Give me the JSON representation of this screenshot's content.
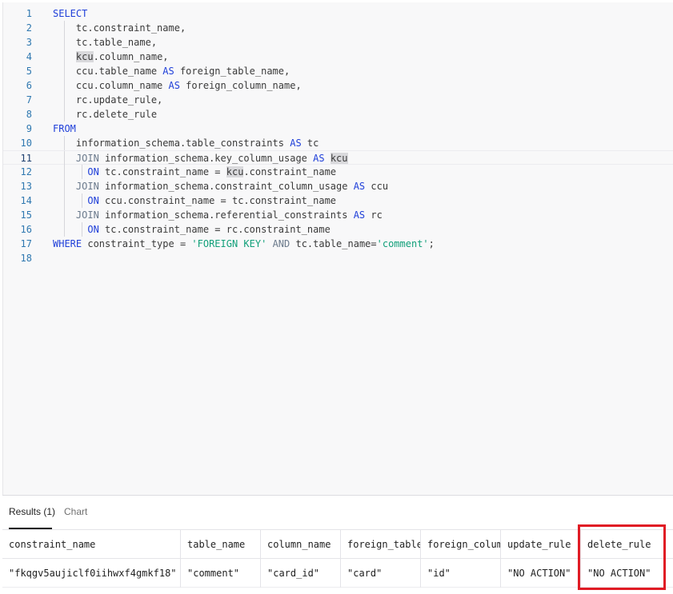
{
  "editor": {
    "lines": [
      {
        "num": "1",
        "tokens": [
          {
            "t": "SELECT",
            "c": "kw"
          }
        ]
      },
      {
        "num": "2",
        "tokens": [
          {
            "t": "    tc.constraint_name,"
          }
        ]
      },
      {
        "num": "3",
        "tokens": [
          {
            "t": "    tc.table_name,"
          }
        ]
      },
      {
        "num": "4",
        "tokens": [
          {
            "t": "    "
          },
          {
            "t": "kcu",
            "c": "hl"
          },
          {
            "t": ".column_name,"
          }
        ]
      },
      {
        "num": "5",
        "tokens": [
          {
            "t": "    ccu.table_name "
          },
          {
            "t": "AS",
            "c": "kw"
          },
          {
            "t": " foreign_table_name,"
          }
        ]
      },
      {
        "num": "6",
        "tokens": [
          {
            "t": "    ccu.column_name "
          },
          {
            "t": "AS",
            "c": "kw"
          },
          {
            "t": " foreign_column_name,"
          }
        ]
      },
      {
        "num": "7",
        "tokens": [
          {
            "t": "    rc.update_rule,"
          }
        ]
      },
      {
        "num": "8",
        "tokens": [
          {
            "t": "    rc.delete_rule"
          }
        ]
      },
      {
        "num": "9",
        "tokens": [
          {
            "t": "FROM",
            "c": "kw"
          }
        ]
      },
      {
        "num": "10",
        "tokens": [
          {
            "t": "    information_schema.table_constraints "
          },
          {
            "t": "AS",
            "c": "kw"
          },
          {
            "t": " tc"
          }
        ]
      },
      {
        "num": "11",
        "active": true,
        "tokens": [
          {
            "t": "    "
          },
          {
            "t": "JOIN",
            "c": "jw"
          },
          {
            "t": " information_schema.key_column_usage "
          },
          {
            "t": "AS",
            "c": "kw"
          },
          {
            "t": " "
          },
          {
            "t": "kcu",
            "c": "hl"
          }
        ]
      },
      {
        "num": "12",
        "tokens": [
          {
            "t": "      "
          },
          {
            "t": "ON",
            "c": "kw"
          },
          {
            "t": " tc.constraint_name = "
          },
          {
            "t": "kcu",
            "c": "hl"
          },
          {
            "t": ".constraint_name"
          }
        ]
      },
      {
        "num": "13",
        "tokens": [
          {
            "t": "    "
          },
          {
            "t": "JOIN",
            "c": "jw"
          },
          {
            "t": " information_schema.constraint_column_usage "
          },
          {
            "t": "AS",
            "c": "kw"
          },
          {
            "t": " ccu"
          }
        ]
      },
      {
        "num": "14",
        "tokens": [
          {
            "t": "      "
          },
          {
            "t": "ON",
            "c": "kw"
          },
          {
            "t": " ccu.constraint_name = tc.constraint_name"
          }
        ]
      },
      {
        "num": "15",
        "tokens": [
          {
            "t": "    "
          },
          {
            "t": "JOIN",
            "c": "jw"
          },
          {
            "t": " information_schema.referential_constraints "
          },
          {
            "t": "AS",
            "c": "kw"
          },
          {
            "t": " rc"
          }
        ]
      },
      {
        "num": "16",
        "tokens": [
          {
            "t": "      "
          },
          {
            "t": "ON",
            "c": "kw"
          },
          {
            "t": " tc.constraint_name = rc.constraint_name"
          }
        ]
      },
      {
        "num": "17",
        "tokens": [
          {
            "t": "WHERE",
            "c": "kw"
          },
          {
            "t": " constraint_type = "
          },
          {
            "t": "'FOREIGN KEY'",
            "c": "str"
          },
          {
            "t": " "
          },
          {
            "t": "AND",
            "c": "jw"
          },
          {
            "t": " tc.table_name="
          },
          {
            "t": "'comment'",
            "c": "str"
          },
          {
            "t": ";"
          }
        ]
      },
      {
        "num": "18",
        "tokens": []
      }
    ]
  },
  "results": {
    "tabs": [
      {
        "label": "Results (1)",
        "active": true
      },
      {
        "label": "Chart",
        "active": false
      }
    ],
    "columns": [
      "constraint_name",
      "table_name",
      "column_name",
      "foreign_table",
      "foreign_colum",
      "update_rule",
      "delete_rule"
    ],
    "rows": [
      [
        "\"fkqgv5aujiclf0iihwxf4gmkf18\"",
        "\"comment\"",
        "\"card_id\"",
        "\"card\"",
        "\"id\"",
        "\"NO ACTION\"",
        "\"NO ACTION\""
      ]
    ]
  },
  "colors": {
    "keyword": "#1f3fd9",
    "string": "#12a07a",
    "highlight_box": "#e01b24"
  }
}
